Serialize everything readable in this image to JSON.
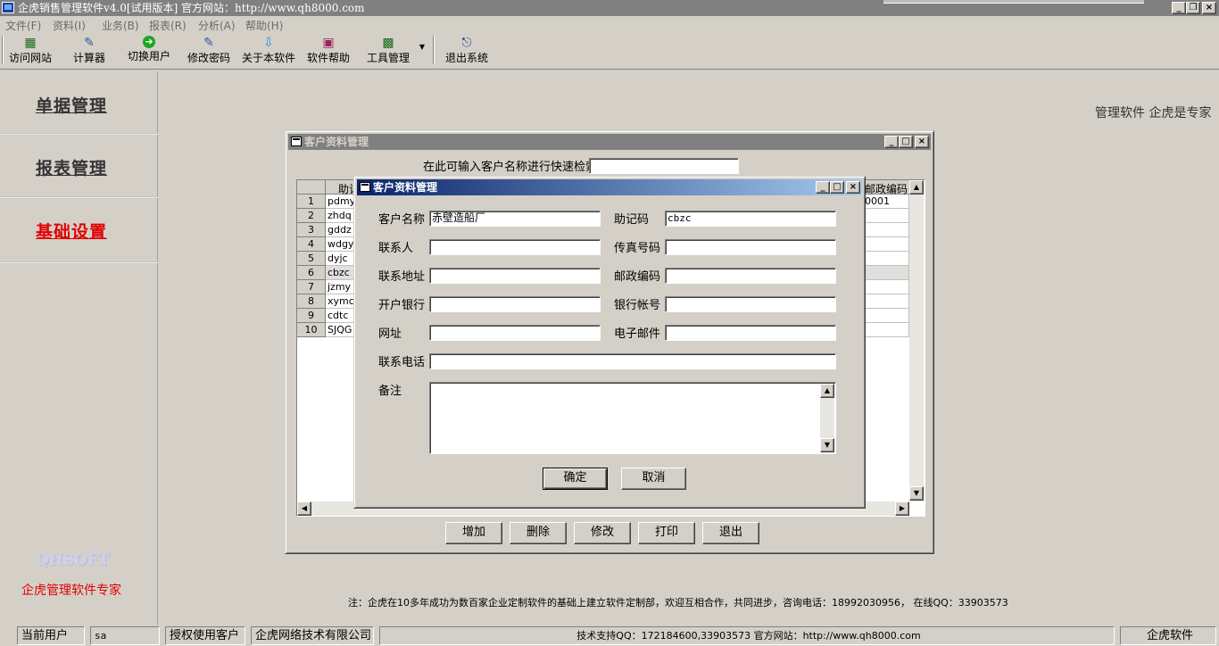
{
  "app": {
    "title": "企虎销售管理软件v4.0[试用版本] 官方网站：http://www.qh8000.com"
  },
  "menu": [
    "文件(F)",
    "资料(I)",
    "业务(B)",
    "报表(R)",
    "分析(A)",
    "帮助(H)"
  ],
  "toolbar": {
    "visit_site": "访问网站",
    "calculator": "计算器",
    "switch_user": "切换用户",
    "change_password": "修改密码",
    "about": "关于本软件",
    "help": "软件帮助",
    "tools": "工具管理",
    "exit": "退出系统"
  },
  "nav": {
    "documents": "单据管理",
    "reports": "报表管理",
    "basic_settings": "基础设置"
  },
  "brand": {
    "logo": "QHSOFT",
    "slogan": "企虎管理软件专家",
    "tagline": "管理软件  企虎是专家"
  },
  "customer_list_window": {
    "title": "客户资料管理",
    "search_label": "在此可输入客户名称进行快速检索",
    "search_value": "",
    "columns": [
      "助记",
      "邮政编码"
    ],
    "rows": [
      {
        "n": "1",
        "code": "pdmy",
        "postal": "0001"
      },
      {
        "n": "2",
        "code": "zhdq",
        "postal": ""
      },
      {
        "n": "3",
        "code": "gddz",
        "postal": ""
      },
      {
        "n": "4",
        "code": "wdgys",
        "postal": ""
      },
      {
        "n": "5",
        "code": "dyjc",
        "postal": ""
      },
      {
        "n": "6",
        "code": "cbzc",
        "postal": ""
      },
      {
        "n": "7",
        "code": "jzmy",
        "postal": ""
      },
      {
        "n": "8",
        "code": "xymc",
        "postal": ""
      },
      {
        "n": "9",
        "code": "cdtc",
        "postal": ""
      },
      {
        "n": "10",
        "code": "SJQG",
        "postal": ""
      }
    ],
    "buttons": {
      "add": "增加",
      "delete": "删除",
      "edit": "修改",
      "print": "打印",
      "exit": "退出"
    }
  },
  "customer_dialog": {
    "title": "客户资料管理",
    "labels": {
      "customer_name": "客户名称",
      "mnemonic": "助记码",
      "contact": "联系人",
      "fax": "传真号码",
      "address": "联系地址",
      "postal_code": "邮政编码",
      "bank": "开户银行",
      "bank_account": "银行帐号",
      "website": "网址",
      "email": "电子邮件",
      "phone": "联系电话",
      "remarks": "备注"
    },
    "values": {
      "customer_name": "赤壁造船厂",
      "mnemonic": "cbzc",
      "contact": "",
      "fax": "",
      "address": "",
      "postal_code": "",
      "bank": "",
      "bank_account": "",
      "website": "",
      "email": "",
      "phone": "",
      "remarks": ""
    },
    "buttons": {
      "ok": "确定",
      "cancel": "取消"
    }
  },
  "footer_note": "注：企虎在10多年成功为数百家企业定制软件的基础上建立软件定制部，欢迎互相合作，共同进步，咨询电话：18992030956，  在线QQ：33903573",
  "statusbar": {
    "current_user_label": "当前用户",
    "current_user": "sa",
    "licensed_label": "授权使用客户",
    "licensed_company": "企虎网络技术有限公司",
    "support": "技术支持QQ：172184600,33903573 官方网站：http://www.qh8000.com",
    "brand": "企虎软件"
  }
}
